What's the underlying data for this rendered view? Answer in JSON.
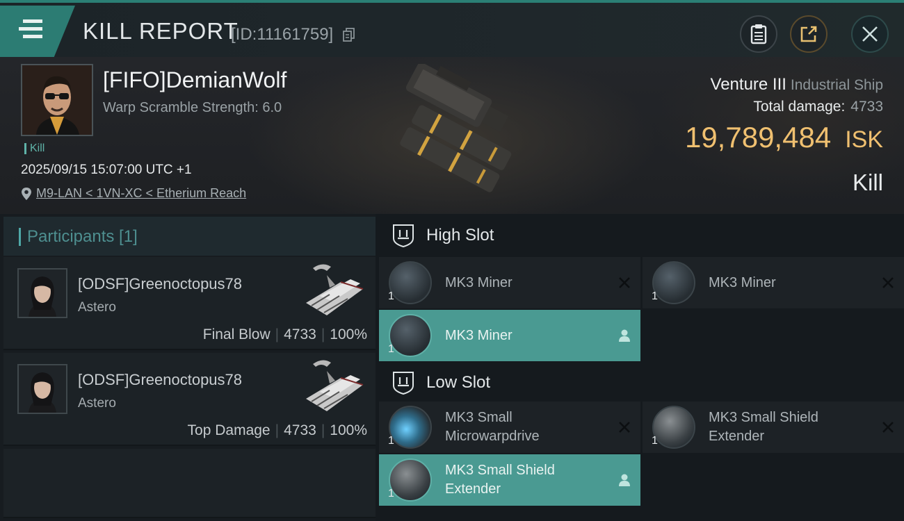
{
  "header": {
    "title": "KILL REPORT",
    "report_id": "[ID:11161759]"
  },
  "victim": {
    "name": "[FIFO]DemianWolf",
    "warp_scramble": "Warp Scramble Strength: 6.0",
    "tag": "Kill",
    "datetime": "2025/09/15 15:07:00 UTC +1",
    "location": "M9-LAN < 1VN-XC < Etherium Reach"
  },
  "ship": {
    "name": "Venture III",
    "class": "Industrial Ship",
    "total_damage_label": "Total damage:",
    "total_damage_value": "4733",
    "isk_value": "19,789,484",
    "isk_unit": "ISK",
    "result": "Kill"
  },
  "participants": {
    "header": "Participants [1]",
    "cards": [
      {
        "name": "[ODSF]Greenoctopus78",
        "ship": "Astero",
        "label": "Final Blow",
        "damage": "4733",
        "percent": "100%"
      },
      {
        "name": "[ODSF]Greenoctopus78",
        "ship": "Astero",
        "label": "Top Damage",
        "damage": "4733",
        "percent": "100%"
      }
    ]
  },
  "fittings": {
    "high_slot": {
      "title": "High Slot",
      "modules": [
        {
          "name": "MK3 Miner",
          "qty": "1",
          "state": "destroyed"
        },
        {
          "name": "MK3 Miner",
          "qty": "1",
          "state": "destroyed"
        },
        {
          "name": "MK3 Miner",
          "qty": "1",
          "state": "dropped"
        }
      ]
    },
    "low_slot": {
      "title": "Low Slot",
      "modules": [
        {
          "name": "MK3 Small Microwarpdrive",
          "qty": "1",
          "state": "destroyed"
        },
        {
          "name": "MK3 Small Shield Extender",
          "qty": "1",
          "state": "destroyed"
        },
        {
          "name": "MK3 Small Shield Extender",
          "qty": "1",
          "state": "dropped"
        }
      ]
    }
  },
  "icons": {
    "menu": "menu-icon",
    "copy": "copy-icon",
    "clipboard": "clipboard-icon",
    "share": "share-icon",
    "close": "close-icon",
    "location": "location-pin-icon",
    "slot": "shield-slot-icon",
    "destroyed": "x-icon",
    "dropped": "person-icon"
  },
  "colors": {
    "accent": "#2c7c73",
    "isk": "#f0c070",
    "active_module": "#4a9a92",
    "participants_label": "#4e8f90"
  }
}
